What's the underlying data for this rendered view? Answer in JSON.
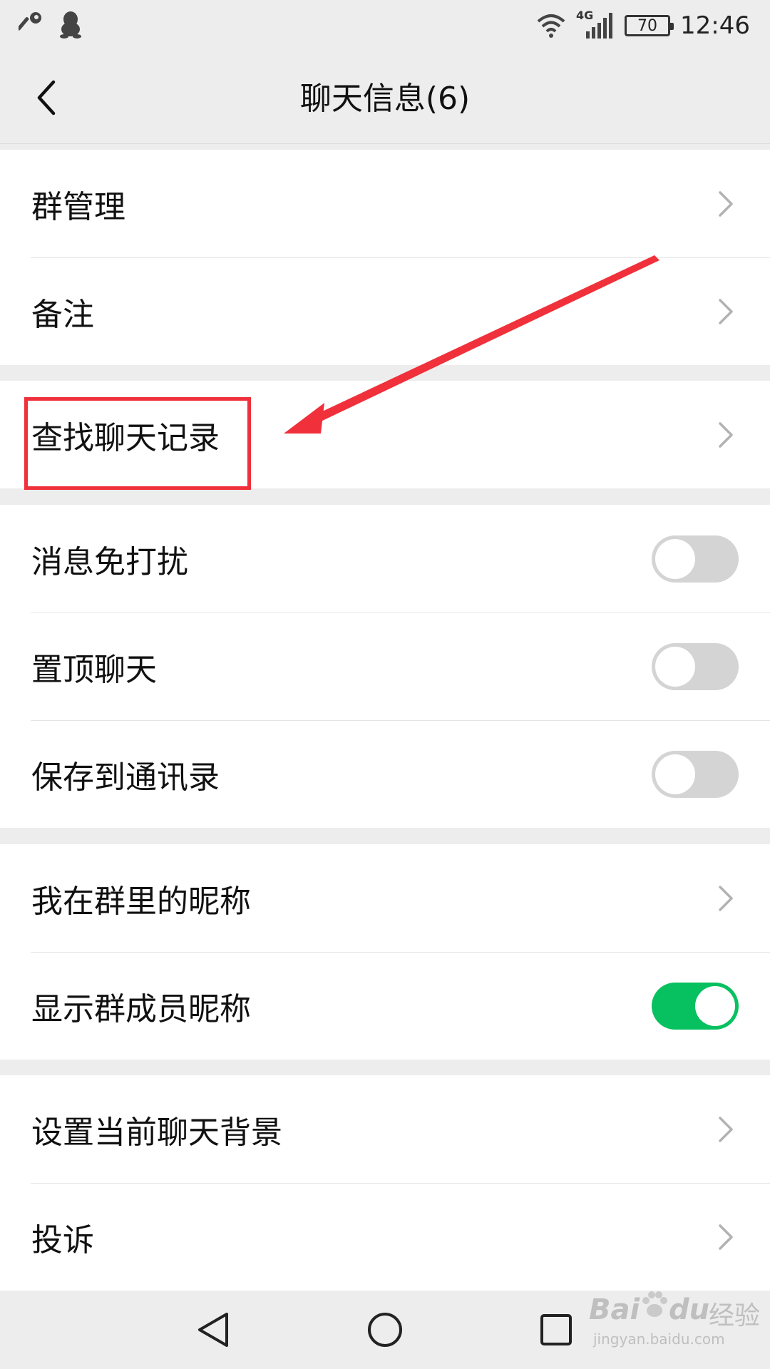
{
  "status_bar": {
    "time": "12:46",
    "battery": "70",
    "network": "4G",
    "icons": [
      "key-icon",
      "qq-penguin-icon",
      "wifi-icon",
      "cellular-signal-icon"
    ]
  },
  "header": {
    "title": "聊天信息(6)",
    "back_icon": "chevron-left-icon"
  },
  "sections": [
    {
      "items": [
        {
          "label": "群管理",
          "control": "chevron"
        },
        {
          "label": "备注",
          "control": "chevron"
        }
      ]
    },
    {
      "items": [
        {
          "label": "查找聊天记录",
          "control": "chevron",
          "highlighted": true
        }
      ]
    },
    {
      "items": [
        {
          "label": "消息免打扰",
          "control": "toggle",
          "on": false
        },
        {
          "label": "置顶聊天",
          "control": "toggle",
          "on": false
        },
        {
          "label": "保存到通讯录",
          "control": "toggle",
          "on": false
        }
      ]
    },
    {
      "items": [
        {
          "label": "我在群里的昵称",
          "control": "chevron"
        },
        {
          "label": "显示群成员昵称",
          "control": "toggle",
          "on": true
        }
      ]
    },
    {
      "items": [
        {
          "label": "设置当前聊天背景",
          "control": "chevron"
        },
        {
          "label": "投诉",
          "control": "chevron"
        }
      ]
    }
  ],
  "annotation": {
    "color": "#f0303a",
    "type": "arrow-and-box",
    "target": "查找聊天记录"
  },
  "system_nav": {
    "buttons": [
      "back-triangle-icon",
      "home-circle-icon",
      "recents-square-icon"
    ]
  },
  "watermark": {
    "brand": "Bai",
    "brand_suffix": "du",
    "cn": "经验",
    "url": "jingyan.baidu.com"
  },
  "colors": {
    "toggle_on": "#07c160",
    "toggle_off": "#d4d4d4",
    "background": "#ededed"
  }
}
